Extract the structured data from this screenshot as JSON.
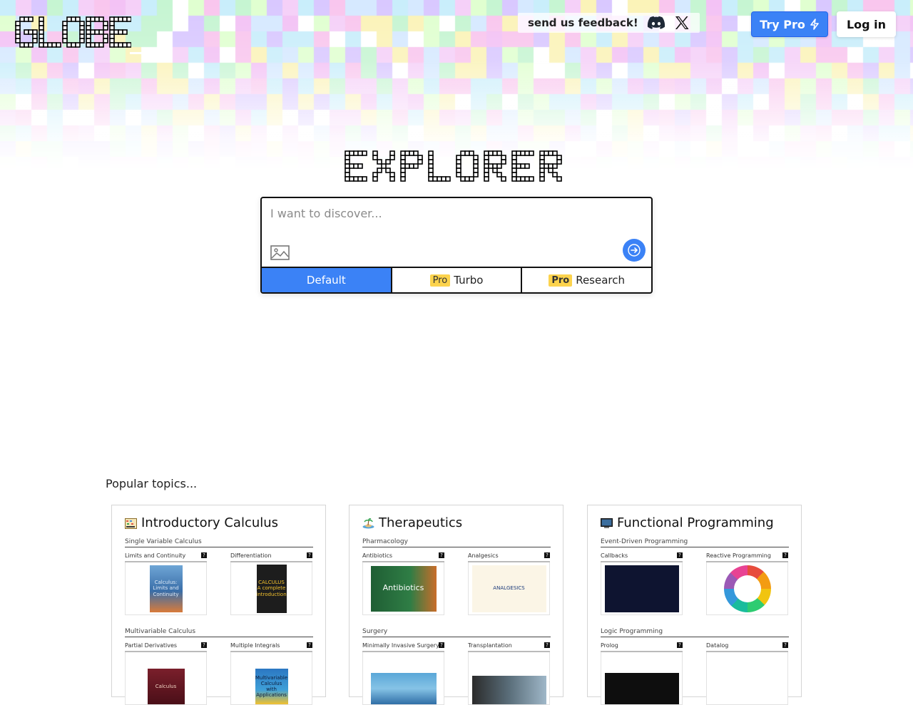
{
  "header": {
    "logo_text": "GLOBE",
    "feedback_label": "send us feedback!",
    "discord_icon": "discord-icon",
    "x_icon": "x-logo-icon",
    "try_pro_label": "Try Pro",
    "login_label": "Log in"
  },
  "hero": {
    "title": "EXPLORER"
  },
  "search": {
    "placeholder": "I want to discover...",
    "value": "",
    "modes": [
      {
        "label": "Default",
        "badge": "",
        "selected": true
      },
      {
        "label": "Turbo",
        "badge": "Pro",
        "selected": false
      },
      {
        "label": "Research",
        "badge": "Pro",
        "selected": false
      }
    ]
  },
  "popular": {
    "label": "Popular topics...",
    "cards": [
      {
        "title": "Introductory Calculus",
        "icon": "abacus-icon",
        "sections": [
          {
            "title": "Single Variable Calculus",
            "items": [
              {
                "label": "Limits and Continuity",
                "thumb": "Calculus: Limits and Continuity"
              },
              {
                "label": "Differentiation",
                "thumb": "CALCULUS A complete introduction"
              }
            ]
          },
          {
            "title": "Multivariable Calculus",
            "items": [
              {
                "label": "Partial Derivatives",
                "thumb": "Calculus"
              },
              {
                "label": "Multiple Integrals",
                "thumb": "Multivariable Calculus with Applications"
              }
            ]
          }
        ]
      },
      {
        "title": "Therapeutics",
        "icon": "island-icon",
        "sections": [
          {
            "title": "Pharmacology",
            "items": [
              {
                "label": "Antibiotics",
                "thumb": "Antibiotics"
              },
              {
                "label": "Analgesics",
                "thumb": "ANALGESICS"
              }
            ]
          },
          {
            "title": "Surgery",
            "items": [
              {
                "label": "Minimally Invasive Surgery",
                "thumb": ""
              },
              {
                "label": "Transplantation",
                "thumb": ""
              }
            ]
          }
        ]
      },
      {
        "title": "Functional Programming",
        "icon": "computer-icon",
        "sections": [
          {
            "title": "Event-Driven Programming",
            "items": [
              {
                "label": "Callbacks",
                "thumb": ""
              },
              {
                "label": "Reactive Programming",
                "thumb": ""
              }
            ]
          },
          {
            "title": "Logic Programming",
            "items": [
              {
                "label": "Prolog",
                "thumb": ""
              },
              {
                "label": "Datalog",
                "thumb": ""
              }
            ]
          }
        ]
      }
    ]
  },
  "colors": {
    "accent": "#3b82f6",
    "pro_badge": "#fcd34d",
    "border": "#111111"
  }
}
